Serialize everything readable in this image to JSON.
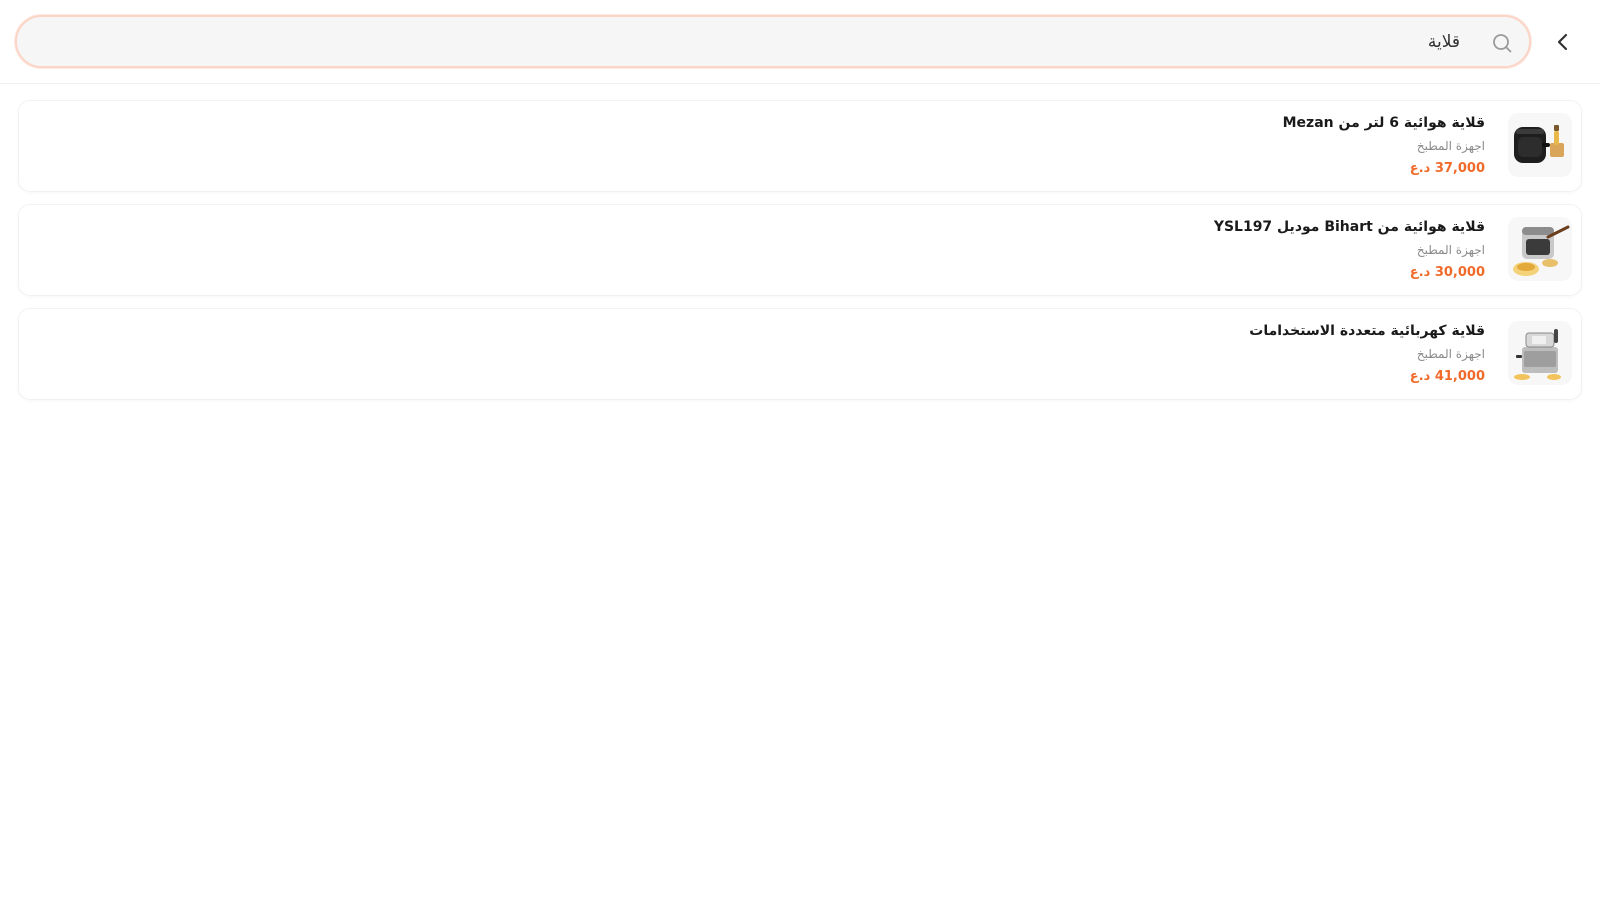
{
  "search": {
    "value": "قلاية",
    "placeholder": ""
  },
  "icons": {
    "back": "chevron-left-icon",
    "search": "search-icon"
  },
  "colors": {
    "accent": "#f06a2a",
    "search_border": "#fbd5c7"
  },
  "results": [
    {
      "title": "قلاية هوائية 6 لتر من Mezan",
      "category": "اجهزة المطبخ",
      "price": "37,000 د.ع",
      "image": "air-fryer-black"
    },
    {
      "title": "قلاية هوائية من Bihart موديل YSL197",
      "category": "اجهزة المطبخ",
      "price": "30,000 د.ع",
      "image": "air-fryer-silver"
    },
    {
      "title": "قلاية كهربائية متعددة الاستخدامات",
      "category": "اجهزة المطبخ",
      "price": "41,000 د.ع",
      "image": "deep-fryer"
    }
  ]
}
